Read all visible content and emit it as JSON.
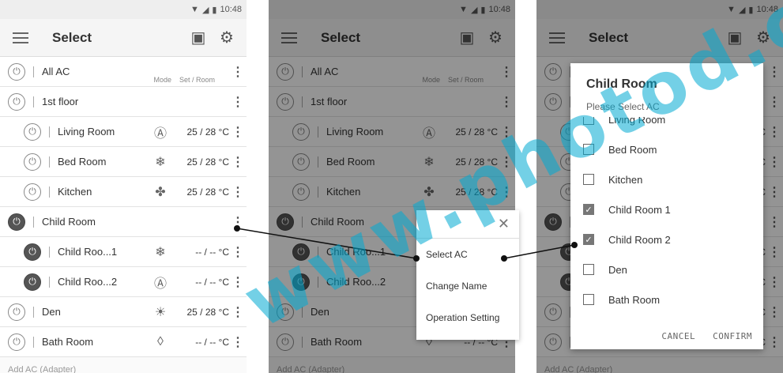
{
  "status": {
    "time": "10:48"
  },
  "toolbar": {
    "title": "Select"
  },
  "list_header": {
    "mode": "Mode",
    "set_room": "Set / Room"
  },
  "rows": [
    {
      "name": "All AC",
      "mode_icon": "none",
      "set": "",
      "power": "off",
      "level": 0
    },
    {
      "name": "1st floor",
      "mode_icon": "none",
      "set": "",
      "power": "off",
      "level": 0
    },
    {
      "name": "Living Room",
      "mode_icon": "auto-icon",
      "mode_glyph": "Ⓐ",
      "set": "25 / 28 °C",
      "power": "off",
      "level": 1
    },
    {
      "name": "Bed Room",
      "mode_icon": "snowflake-icon",
      "mode_glyph": "❄",
      "set": "25 / 28 °C",
      "power": "off",
      "level": 1
    },
    {
      "name": "Kitchen",
      "mode_icon": "fan-icon",
      "mode_glyph": "✤",
      "set": "25 / 28 °C",
      "power": "off",
      "level": 1
    },
    {
      "name": "Child Room",
      "mode_icon": "none",
      "set": "",
      "power": "on",
      "level": 0
    },
    {
      "name": "Child Roo...1",
      "mode_icon": "snowflake-icon",
      "mode_glyph": "❄",
      "set": "-- / --  °C",
      "power": "on",
      "level": 1
    },
    {
      "name": "Child Roo...2",
      "mode_icon": "auto-icon",
      "mode_glyph": "Ⓐ",
      "set": "-- / --  °C",
      "power": "on",
      "level": 1
    },
    {
      "name": "Den",
      "mode_icon": "sun-icon",
      "mode_glyph": "☀",
      "set": "25 / 28 °C",
      "power": "off",
      "level": 0
    },
    {
      "name": "Bath Room",
      "mode_icon": "dry-icon",
      "mode_glyph": "◊",
      "set": "-- / --  °C",
      "power": "off",
      "level": 0
    }
  ],
  "footer": {
    "text": "Add AC (Adapter)"
  },
  "popup": {
    "items": [
      "Select AC",
      "Change Name",
      "Operation Setting"
    ]
  },
  "dialog": {
    "title": "Child Room",
    "subtitle": "Please Select AC",
    "items": [
      {
        "label": "Living Room",
        "checked": false
      },
      {
        "label": "Bed Room",
        "checked": false
      },
      {
        "label": "Kitchen",
        "checked": false
      },
      {
        "label": "Child Room 1",
        "checked": true
      },
      {
        "label": "Child Room 2",
        "checked": true
      },
      {
        "label": "Den",
        "checked": false
      },
      {
        "label": "Bath Room",
        "checked": false
      }
    ],
    "cancel": "CANCEL",
    "confirm": "CONFIRM"
  },
  "watermark": "www.photod.c"
}
